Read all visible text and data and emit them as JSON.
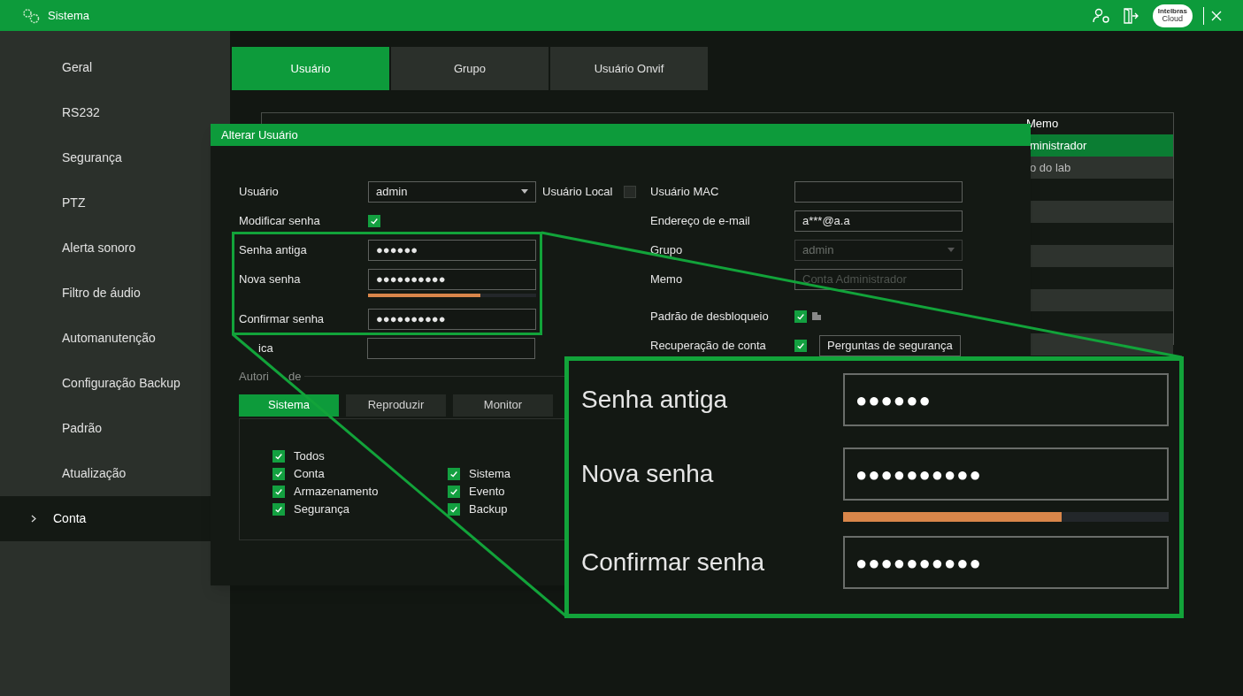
{
  "title_bar": {
    "title": "Sistema",
    "cloud_logo": {
      "brand": "Intelbras",
      "label": "Cloud"
    }
  },
  "sidebar": {
    "items": [
      {
        "label": "Geral",
        "selected": false
      },
      {
        "label": "RS232",
        "selected": false
      },
      {
        "label": "Segurança",
        "selected": false
      },
      {
        "label": "PTZ",
        "selected": false
      },
      {
        "label": "Alerta sonoro",
        "selected": false
      },
      {
        "label": "Filtro de áudio",
        "selected": false
      },
      {
        "label": "Automanutenção",
        "selected": false
      },
      {
        "label": "Configuração Backup",
        "selected": false
      },
      {
        "label": "Padrão",
        "selected": false
      },
      {
        "label": "Atualização",
        "selected": false
      },
      {
        "label": "Conta",
        "selected": true
      }
    ]
  },
  "tabs": [
    {
      "label": "Usuário",
      "selected": true
    },
    {
      "label": "Grupo",
      "selected": false
    },
    {
      "label": "Usuário Onvif",
      "selected": false
    }
  ],
  "user_table": {
    "memo_header": "Memo",
    "rows": [
      {
        "memo": "ministrador",
        "selected": true
      },
      {
        "memo": "o do lab",
        "selected": false
      }
    ]
  },
  "dialog": {
    "title": "Alterar Usuário",
    "user": {
      "label": "Usuário",
      "value": "admin"
    },
    "local_user": {
      "label": "Usuário Local",
      "checked": false
    },
    "modify_password": {
      "label": "Modificar senha",
      "checked": true
    },
    "old_password": {
      "label": "Senha antiga",
      "value": "●●●●●●"
    },
    "new_password": {
      "label": "Nova senha",
      "value": "●●●●●●●●●●"
    },
    "strength": {
      "level": 0.67
    },
    "confirm_password": {
      "label": "Confirmar senha",
      "value": "●●●●●●●●●●"
    },
    "hint": {
      "label": "ica"
    },
    "right_fields": [
      {
        "kind": "text",
        "label": "Usuário MAC"
      },
      {
        "kind": "text",
        "label": "Endereço de e-mail",
        "value": "a***@a.a"
      },
      {
        "kind": "select",
        "label": "Grupo",
        "value": "admin",
        "disabled": true
      },
      {
        "kind": "text",
        "label": "Memo",
        "placeholder": "Conta Administrador"
      },
      {
        "kind": "checkbox",
        "label": "Padrão de desbloqueio",
        "checked": true
      },
      {
        "kind": "checkbox_field",
        "label": "Recuperação de conta",
        "checked": true,
        "value": "Perguntas de segurança"
      }
    ],
    "authority": {
      "label": "Autori",
      "label_end": "de",
      "tabs": [
        {
          "label": "Sistema",
          "selected": true
        },
        {
          "label": "Reproduzir",
          "selected": false
        },
        {
          "label": "Monitor",
          "selected": false
        }
      ],
      "columns": [
        {
          "items": [
            {
              "label": "Todos",
              "checked": true
            },
            {
              "label": "Conta",
              "checked": true
            },
            {
              "label": "Armazenamento",
              "checked": true
            },
            {
              "label": "Segurança",
              "checked": true
            }
          ]
        },
        {
          "items": [
            {
              "label": "Sistema",
              "checked": true
            },
            {
              "label": "Evento",
              "checked": true
            },
            {
              "label": "Backup",
              "checked": true
            }
          ]
        }
      ]
    }
  },
  "magnifier": {
    "fields": [
      {
        "label": "Senha antiga",
        "value": "●●●●●●"
      },
      {
        "label": "Nova senha",
        "value": "●●●●●●●●●●"
      },
      {
        "label": "Confirmar senha",
        "value": "●●●●●●●●●●"
      }
    ],
    "strength": {
      "level": 0.67
    }
  }
}
